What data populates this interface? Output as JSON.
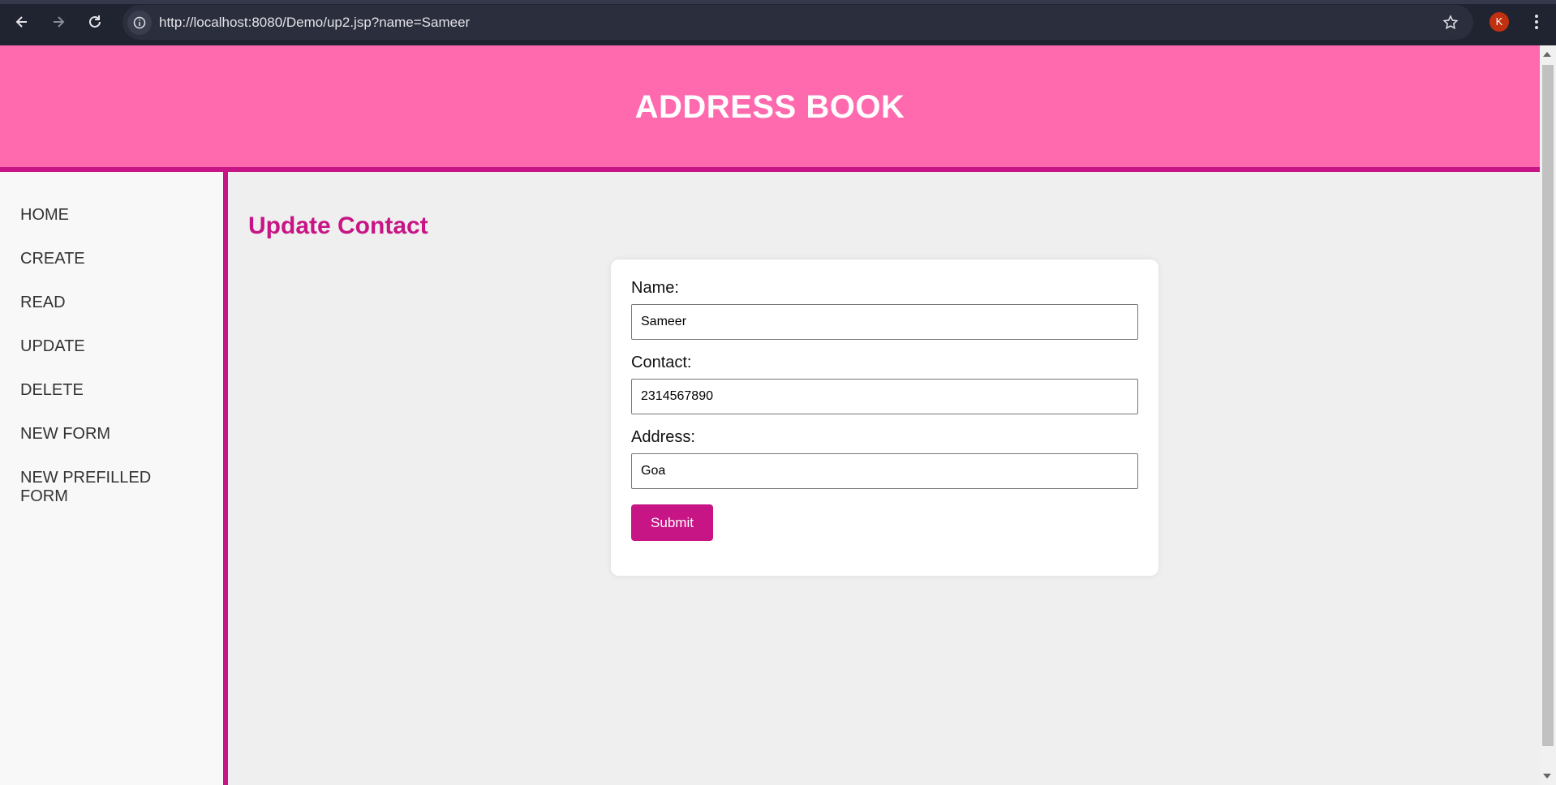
{
  "browser": {
    "url": "http://localhost:8080/Demo/up2.jsp?name=Sameer",
    "profile_initial": "K"
  },
  "header": {
    "title": "ADDRESS BOOK"
  },
  "sidebar": {
    "items": [
      {
        "label": "HOME"
      },
      {
        "label": "CREATE"
      },
      {
        "label": "READ"
      },
      {
        "label": "UPDATE"
      },
      {
        "label": "DELETE"
      },
      {
        "label": "NEW FORM"
      },
      {
        "label": "NEW PREFILLED FORM"
      }
    ]
  },
  "main": {
    "title": "Update Contact",
    "form": {
      "name_label": "Name:",
      "name_value": "Sameer",
      "contact_label": "Contact:",
      "contact_value": "2314567890",
      "address_label": "Address:",
      "address_value": "Goa",
      "submit_label": "Submit"
    }
  },
  "colors": {
    "header_bg": "#ff69ad",
    "accent": "#c71585",
    "page_bg": "#efefef"
  }
}
